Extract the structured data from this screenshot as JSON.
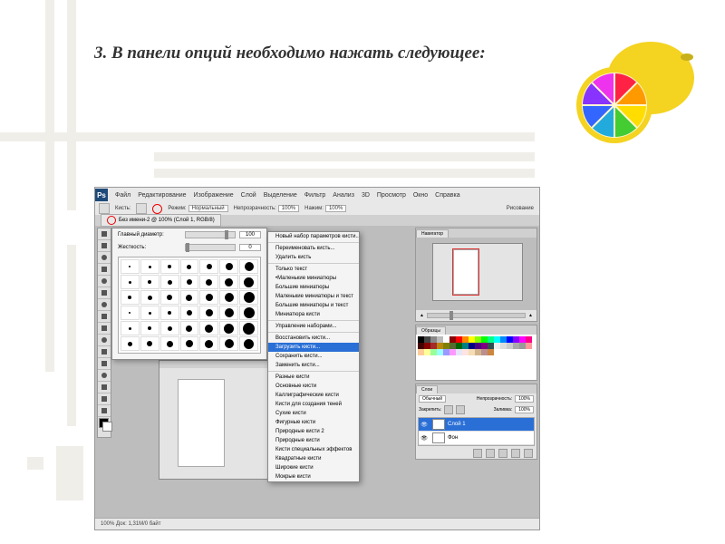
{
  "heading": "3. В панели опций необходимо нажать следующее:",
  "menubar": {
    "items": [
      "Файл",
      "Редактирование",
      "Изображение",
      "Слой",
      "Выделение",
      "Фильтр",
      "Анализ",
      "3D",
      "Просмотр",
      "Окно",
      "Справка"
    ]
  },
  "optbar": {
    "tool_label": "Кисть:",
    "mode_label": "Режим:",
    "mode_value": "Нормальный",
    "opacity_label": "Непрозрачность:",
    "opacity_value": "100%",
    "flow_label": "Нажим:",
    "flow_value": "100%",
    "right_label": "Рисование"
  },
  "doc_tab": "Без имени-2 @ 100% (Слой 1, RGB/8)",
  "brush_popup": {
    "size_label": "Главный диаметр:",
    "size_value": "100",
    "hard_label": "Жесткость:",
    "hard_value": "0"
  },
  "context_menu": {
    "items": [
      {
        "t": "Новый набор параметров кисти..."
      },
      {
        "sep": true
      },
      {
        "t": "Переименовать кисть..."
      },
      {
        "t": "Удалить кисть"
      },
      {
        "sep": true
      },
      {
        "t": "Только текст"
      },
      {
        "t": "Маленькие миниатюры",
        "chk": true
      },
      {
        "t": "Большие миниатюры"
      },
      {
        "t": "Маленькие миниатюры и текст"
      },
      {
        "t": "Большие миниатюры и текст"
      },
      {
        "t": "Миниатюра кисти"
      },
      {
        "sep": true
      },
      {
        "t": "Управление наборами..."
      },
      {
        "sep": true
      },
      {
        "t": "Восстановить кисти..."
      },
      {
        "t": "Загрузить кисти...",
        "hl": true
      },
      {
        "t": "Сохранить кисти..."
      },
      {
        "t": "Заменить кисти..."
      },
      {
        "sep": true
      },
      {
        "t": "Разные кисти"
      },
      {
        "t": "Основные кисти"
      },
      {
        "t": "Каллиграфические кисти"
      },
      {
        "t": "Кисти для создания теней"
      },
      {
        "t": "Сухие кисти"
      },
      {
        "t": "Фигурные кисти"
      },
      {
        "t": "Природные кисти 2"
      },
      {
        "t": "Природные кисти"
      },
      {
        "t": "Кисти специальных эффектов"
      },
      {
        "t": "Квадратные кисти"
      },
      {
        "t": "Широкие кисти"
      },
      {
        "t": "Мокрые кисти"
      }
    ]
  },
  "panels": {
    "navigator_tab": "Навигатор",
    "swatches_tab": "Образцы",
    "layers": {
      "tab": "Слои",
      "mode_label": "Обычный",
      "opacity_label": "Непрозрачность:",
      "opacity_value": "100%",
      "lock_label": "Закрепить:",
      "fill_label": "Заливка:",
      "fill_value": "100%",
      "rows": [
        {
          "name": "Слой 1",
          "sel": true
        },
        {
          "name": "Фон",
          "sel": false
        }
      ]
    }
  },
  "status": "100%    Док: 1,31M/0 байт",
  "swatch_colors": [
    "#000",
    "#444",
    "#888",
    "#bbb",
    "#fff",
    "#8b0000",
    "#f00",
    "#f80",
    "#ff0",
    "#8f0",
    "#0f0",
    "#0f8",
    "#0ff",
    "#08f",
    "#00f",
    "#80f",
    "#f0f",
    "#f08",
    "#400",
    "#800",
    "#a52a2a",
    "#b8860b",
    "#808000",
    "#556b2f",
    "#006400",
    "#008080",
    "#000080",
    "#4b0082",
    "#800080",
    "#2f4f4f",
    "#eee",
    "#ddd",
    "#ccc",
    "#aaa",
    "#999",
    "#f99",
    "#fc9",
    "#ff9",
    "#9f9",
    "#9ff",
    "#99f",
    "#f9f",
    "#e6e6fa",
    "#ffe4e1",
    "#f5deb3",
    "#d2b48c",
    "#bc8f8f",
    "#cd853f"
  ]
}
